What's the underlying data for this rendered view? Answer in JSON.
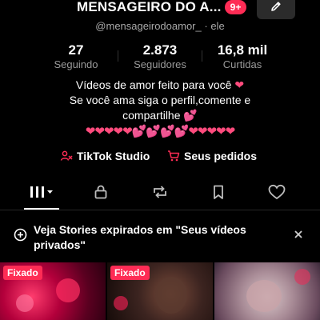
{
  "header": {
    "username": "MENSAGEIRO DO A...",
    "notification_badge": "9+",
    "edit_icon": "pencil-icon"
  },
  "profile": {
    "handle": "@mensageirodoamor_",
    "separator": "·",
    "pronoun": "ele"
  },
  "stats": [
    {
      "value": "27",
      "label": "Seguindo"
    },
    {
      "value": "2.873",
      "label": "Seguidores"
    },
    {
      "value": "16,8 mil",
      "label": "Curtidas"
    }
  ],
  "bio": {
    "line1": "Vídeos de amor feito para você",
    "line2": "Se você ama siga o perfil,comente e",
    "line3": "compartilhe",
    "heart_emoji": "❤",
    "sparkle_heart_emoji": "💕",
    "hearts_row": "❤❤❤❤❤💕💕💕💕❤❤❤❤❤"
  },
  "links": {
    "studio_label": "TikTok Studio",
    "orders_label": "Seus pedidos"
  },
  "tabs": [
    {
      "icon": "grid-videos-icon",
      "active": true
    },
    {
      "icon": "lock-icon",
      "active": false
    },
    {
      "icon": "repost-icon",
      "active": false
    },
    {
      "icon": "bookmark-icon",
      "active": false
    },
    {
      "icon": "heart-outline-icon",
      "active": false
    }
  ],
  "banner": {
    "text": "Veja Stories expirados em \"Seus vídeos privados\"",
    "icon": "add-story-icon",
    "close_icon": "close-icon"
  },
  "videos": [
    {
      "badge": "Fixado"
    },
    {
      "badge": "Fixado"
    },
    {
      "badge": ""
    }
  ],
  "colors": {
    "accent": "#fe2c55",
    "background": "#000000",
    "muted_text": "#9a9a9a"
  }
}
